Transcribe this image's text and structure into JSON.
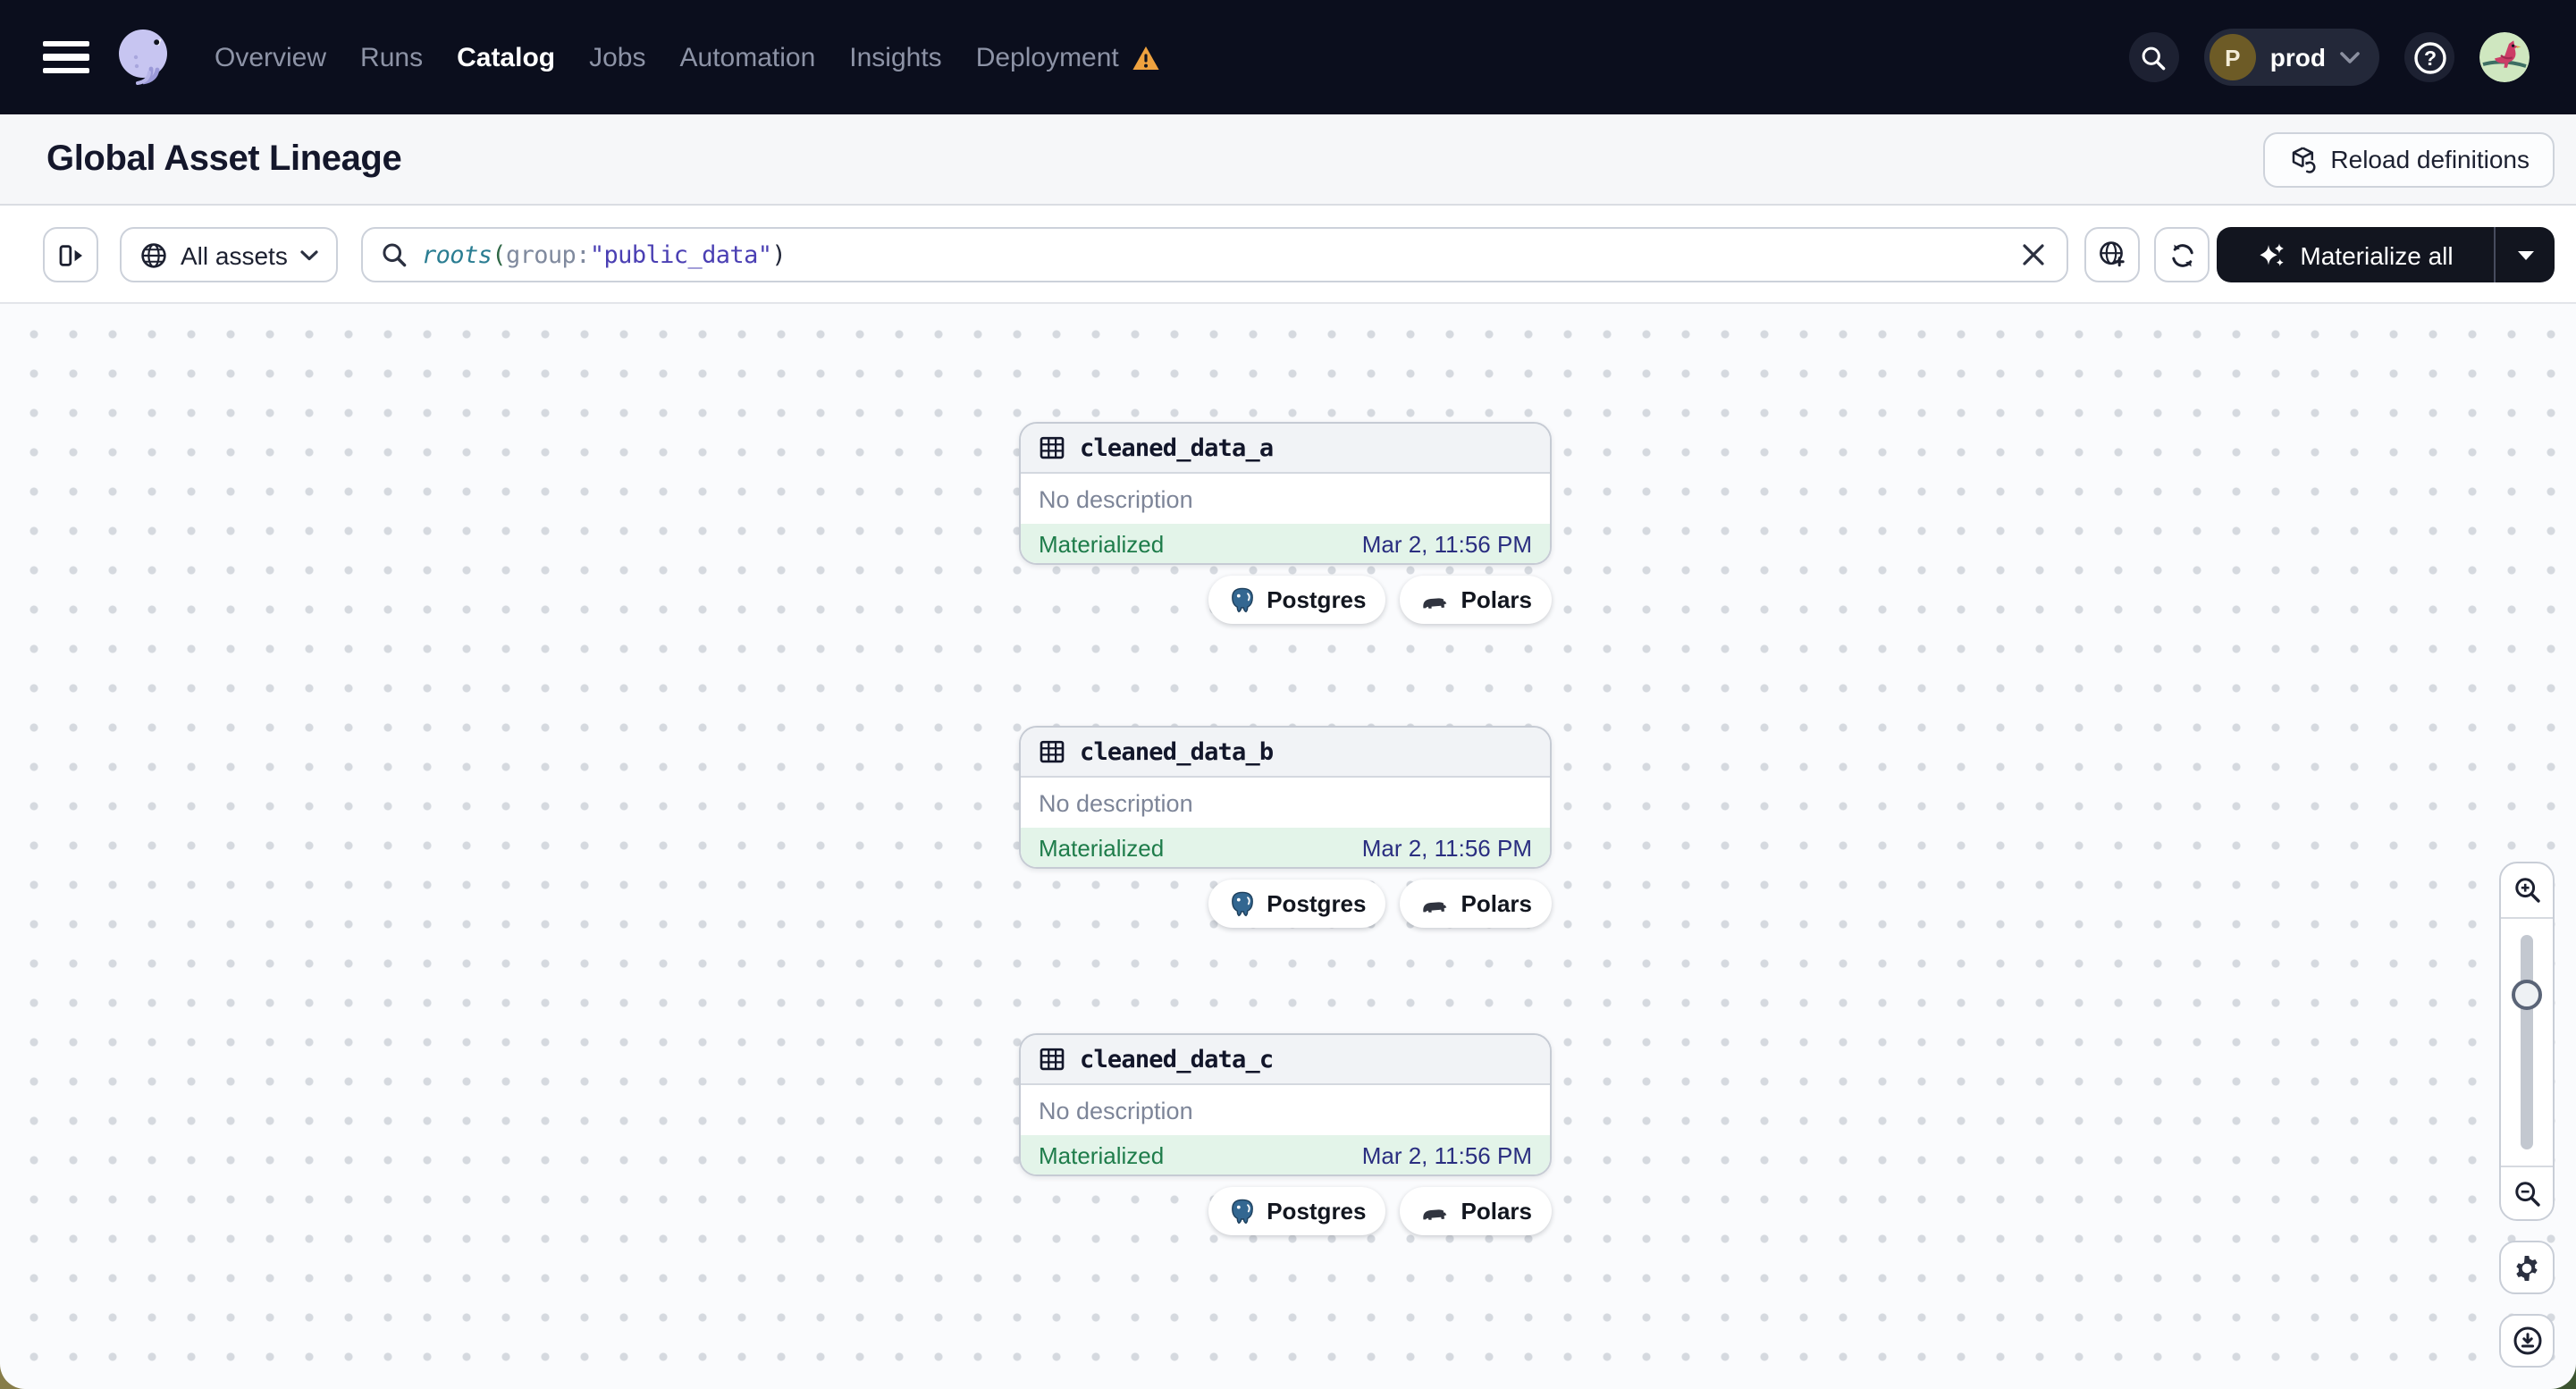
{
  "nav": {
    "items": [
      {
        "label": "Overview"
      },
      {
        "label": "Runs"
      },
      {
        "label": "Catalog",
        "active": true
      },
      {
        "label": "Jobs"
      },
      {
        "label": "Automation"
      },
      {
        "label": "Insights"
      },
      {
        "label": "Deployment",
        "warning": true
      }
    ],
    "environment": {
      "initial": "P",
      "name": "prod"
    }
  },
  "header": {
    "title": "Global Asset Lineage",
    "reload_label": "Reload definitions"
  },
  "toolbar": {
    "scope_label": "All assets",
    "query": {
      "fn": "roots",
      "open": "(",
      "field": "group",
      "colon": ":",
      "value": "\"public_data\"",
      "close": ")"
    },
    "materialize_label": "Materialize all"
  },
  "graph": {
    "nodes": [
      {
        "name": "cleaned_data_a",
        "description": "No description",
        "status": "Materialized",
        "timestamp": "Mar 2, 11:56 PM",
        "badges": [
          "Postgres",
          "Polars"
        ]
      },
      {
        "name": "cleaned_data_b",
        "description": "No description",
        "status": "Materialized",
        "timestamp": "Mar 2, 11:56 PM",
        "badges": [
          "Postgres",
          "Polars"
        ]
      },
      {
        "name": "cleaned_data_c",
        "description": "No description",
        "status": "Materialized",
        "timestamp": "Mar 2, 11:56 PM",
        "badges": [
          "Postgres",
          "Polars"
        ]
      }
    ]
  },
  "icons": {
    "nav": [
      "menu-icon",
      "dagster-logo",
      "warning-icon",
      "search-icon",
      "chevron-down-icon",
      "help-icon",
      "avatar"
    ],
    "toolbar": [
      "panel-toggle-icon",
      "globe-icon",
      "search-icon",
      "clear-icon",
      "globe-plus-icon",
      "refresh-icon",
      "sparkles-icon",
      "caret-down-icon"
    ],
    "node": [
      "table-icon",
      "postgres-icon",
      "polars-icon"
    ],
    "controls": [
      "zoom-in-icon",
      "zoom-out-icon",
      "gear-icon",
      "download-icon"
    ]
  },
  "colors": {
    "nav_bg": "#0b0e1d",
    "warning": "#efa23f",
    "materialized_text": "#1e7c4a",
    "materialized_bg": "#e3f4e9",
    "timestamp": "#2a2e80",
    "query_fn": "#2a7d92",
    "query_value": "#4a3fb3",
    "postgres_blue": "#336791",
    "materialize_button_bg": "#12151f"
  }
}
